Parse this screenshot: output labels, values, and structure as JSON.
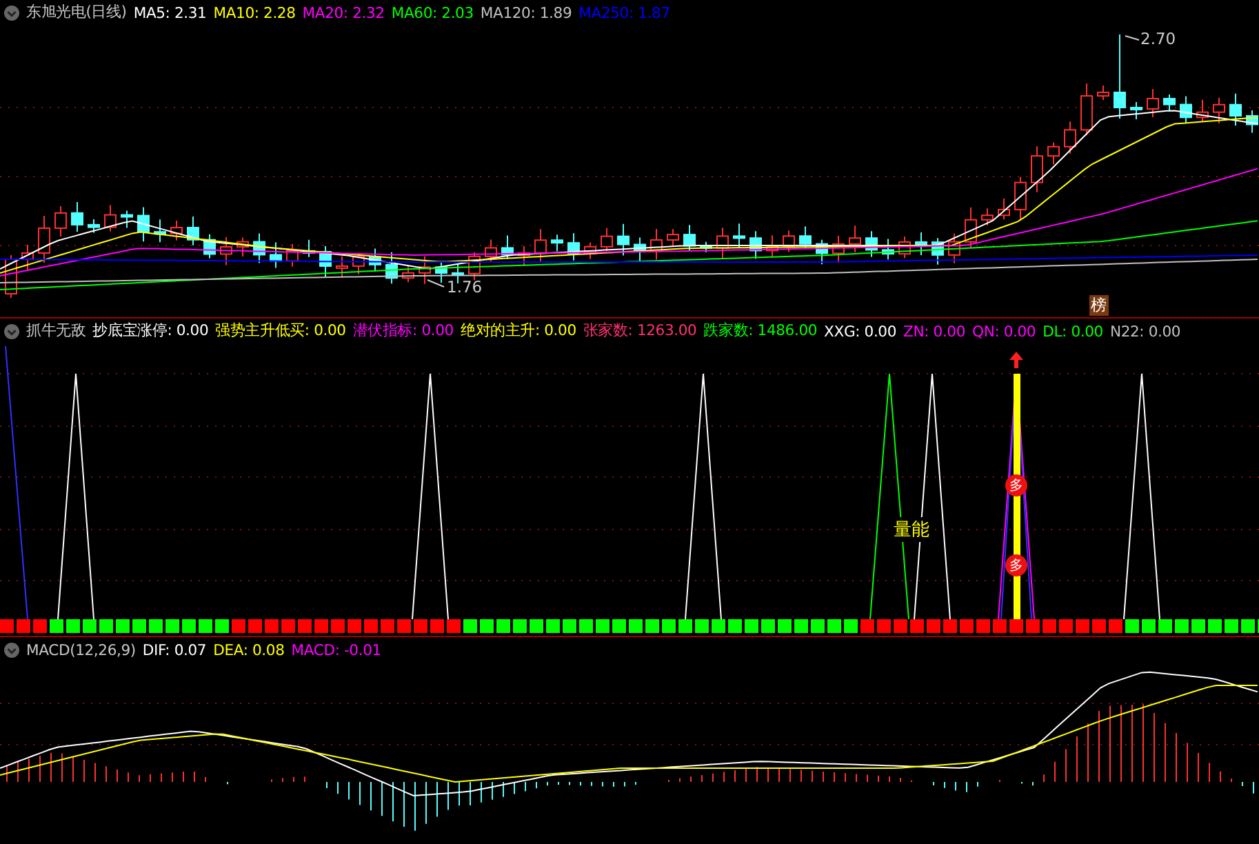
{
  "main_pane": {
    "title": "东旭光电(日线)",
    "indicators": [
      {
        "label": "MA5: 2.31",
        "color": "#ffffff"
      },
      {
        "label": "MA10: 2.28",
        "color": "#ffff00"
      },
      {
        "label": "MA20: 2.32",
        "color": "#ff00ff"
      },
      {
        "label": "MA60: 2.03",
        "color": "#00ff00"
      },
      {
        "label": "MA120: 1.89",
        "color": "#c0c0c0"
      },
      {
        "label": "MA250: 1.87",
        "color": "#0000ff"
      }
    ],
    "high_label": "2.70",
    "low_label": "1.76",
    "badge": "榜"
  },
  "signal_pane": {
    "title": "抓牛无敌",
    "indicators": [
      {
        "label": "抄底宝涨停: 0.00",
        "color": "#ffffff"
      },
      {
        "label": "强势主升低买: 0.00",
        "color": "#ffff00"
      },
      {
        "label": "潜伏指标: 0.00",
        "color": "#ff00ff"
      },
      {
        "label": "绝对的主升: 0.00",
        "color": "#ffff00"
      },
      {
        "label": "张家数: 1263.00",
        "color": "#ff3070"
      },
      {
        "label": "跌家数: 1486.00",
        "color": "#00ff00"
      },
      {
        "label": "XXG: 0.00",
        "color": "#ffffff"
      },
      {
        "label": "ZN: 0.00",
        "color": "#ff00ff"
      },
      {
        "label": "QN: 0.00",
        "color": "#ff00ff"
      },
      {
        "label": "DL: 0.00",
        "color": "#00ff00"
      },
      {
        "label": "N22: 0.00",
        "color": "#c0c0c0"
      }
    ],
    "volume_label": "量能",
    "markers": [
      "多",
      "多"
    ]
  },
  "macd_pane": {
    "title": "MACD(12,26,9)",
    "indicators": [
      {
        "label": "DIF: 0.07",
        "color": "#ffffff"
      },
      {
        "label": "DEA: 0.08",
        "color": "#ffff00"
      },
      {
        "label": "MACD: -0.01",
        "color": "#ff00ff"
      }
    ]
  }
}
